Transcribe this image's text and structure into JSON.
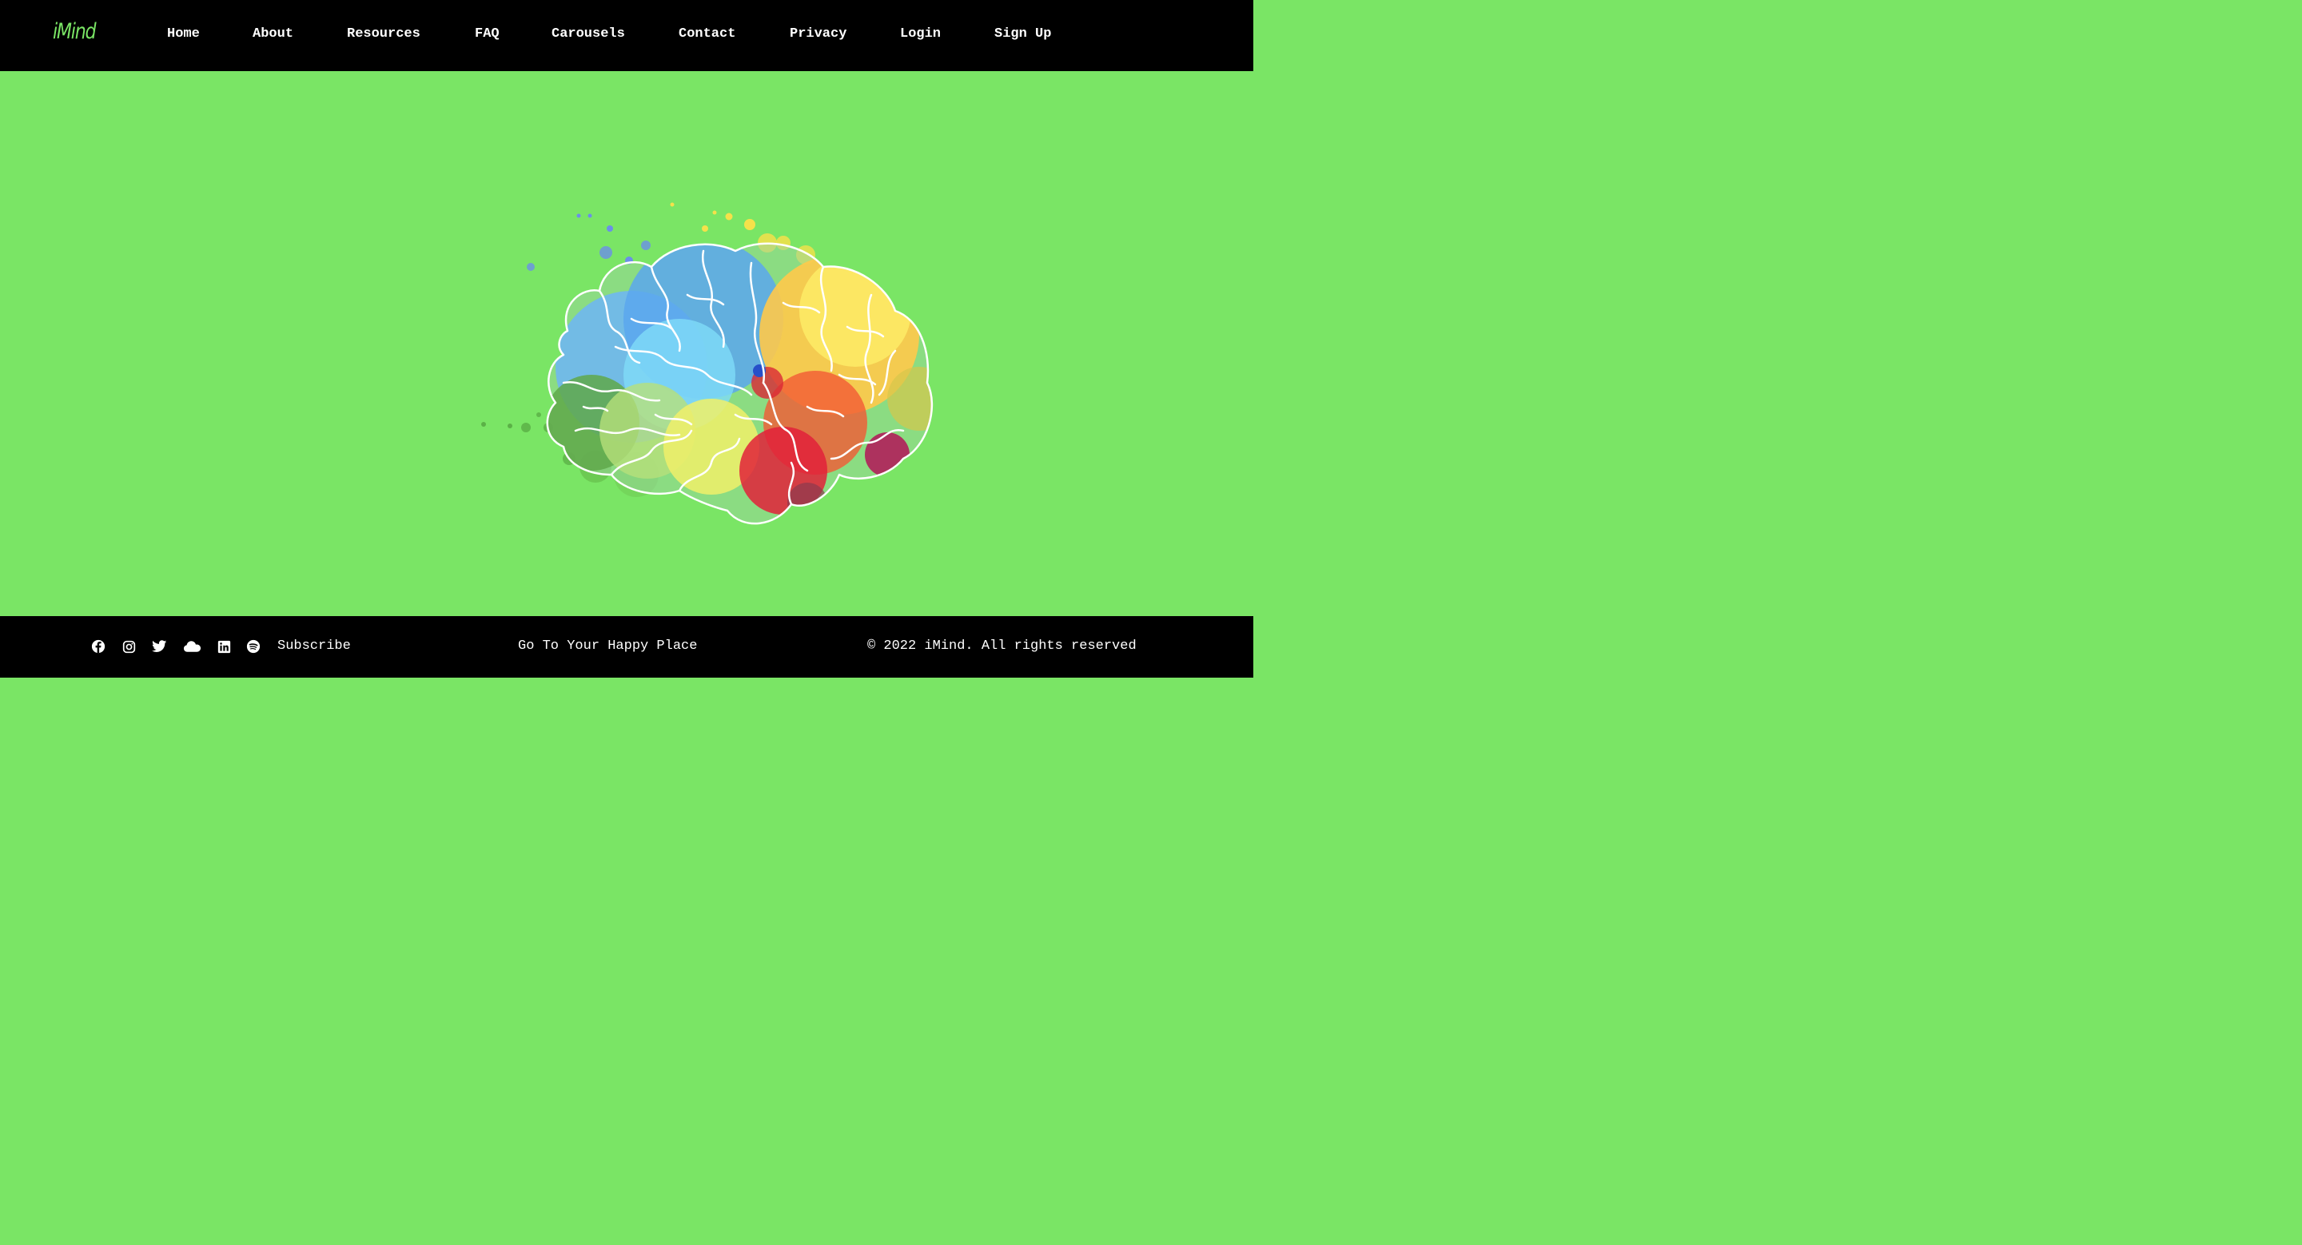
{
  "header": {
    "brand": "iMind",
    "nav": [
      {
        "label": "Home"
      },
      {
        "label": "About"
      },
      {
        "label": "Resources"
      },
      {
        "label": "FAQ"
      },
      {
        "label": "Carousels"
      },
      {
        "label": "Contact"
      },
      {
        "label": "Privacy"
      },
      {
        "label": "Login"
      },
      {
        "label": "Sign Up"
      }
    ]
  },
  "hero": {
    "image": "colorful-brain-illustration",
    "background_color": "#7ae565"
  },
  "footer": {
    "social_icons": [
      "facebook-icon",
      "instagram-icon",
      "twitter-icon",
      "soundcloud-icon",
      "linkedin-icon",
      "spotify-icon"
    ],
    "subscribe": "Subscribe",
    "tagline": "Go To Your Happy Place",
    "copyright": "© 2022 iMind. All rights reserved"
  },
  "colors": {
    "brand": "#7ae565",
    "header_bg": "#000000",
    "text": "#ffffff"
  }
}
